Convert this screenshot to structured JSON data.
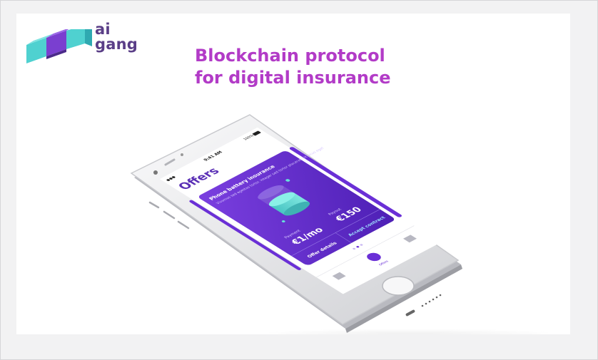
{
  "brand": {
    "name_line1": "ai",
    "name_line2": "gang",
    "logo_colors": {
      "teal": "#4fd1d0",
      "purple": "#7a3fd0",
      "dark_purple": "#4b2a8a"
    }
  },
  "headline": {
    "line1": "Blockchain protocol",
    "line2": "for digital insurance",
    "color": "#b23bc7"
  },
  "phone_screen": {
    "status": {
      "time": "9:41 AM",
      "battery": "100%"
    },
    "title": "Offers",
    "card": {
      "title": "Phone battery insurance",
      "description": "Vivamus sed egestas tortor. Integer sed tortor placerat, sit lacus eget",
      "payment_label": "Payment",
      "payment_value": "€1/mo",
      "payout_label": "Payout",
      "payout_value": "€150",
      "details_button": "Offer details",
      "accept_button": "Accept contract"
    },
    "tabbar": {
      "center_label": "Offers"
    },
    "accent_color": "#6a2fd6"
  }
}
